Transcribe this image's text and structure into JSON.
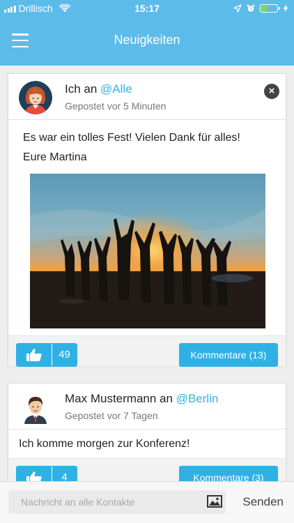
{
  "status_bar": {
    "carrier": "Drillisch",
    "time": "15:17",
    "icons": [
      "signal-icon",
      "wifi-icon",
      "location-icon",
      "alarm-icon",
      "battery-icon",
      "charging-icon"
    ]
  },
  "header": {
    "title": "Neuigkeiten",
    "menu_icon": "hamburger-menu-icon",
    "background_color": "#5dbbea"
  },
  "posts": [
    {
      "author": "Ich an ",
      "audience": "@Alle",
      "time": "Gepostet vor 5 Minuten",
      "lines": [
        "Es war ein tolles Fest! Vielen Dank für alles!",
        "Eure Martina"
      ],
      "likes": "49",
      "comments_label": "Kommentare (13)",
      "has_image": true,
      "image_description_icon": "group-at-sunset-photo"
    },
    {
      "author": "Max Mustermann an ",
      "audience": "@Berlin",
      "time": "Gepostet vor 7 Tagen",
      "lines": [
        "Ich komme morgen zur Konferenz!"
      ],
      "likes": "4",
      "comments_label": "Kommentare (3)",
      "has_image": false
    }
  ],
  "compose": {
    "placeholder": "Nachricht an alle Kontakte",
    "send_label": "Senden",
    "attach_icon": "image-attach-icon"
  },
  "colors": {
    "accent": "#2fb1e5",
    "link": "#3aaee0"
  }
}
